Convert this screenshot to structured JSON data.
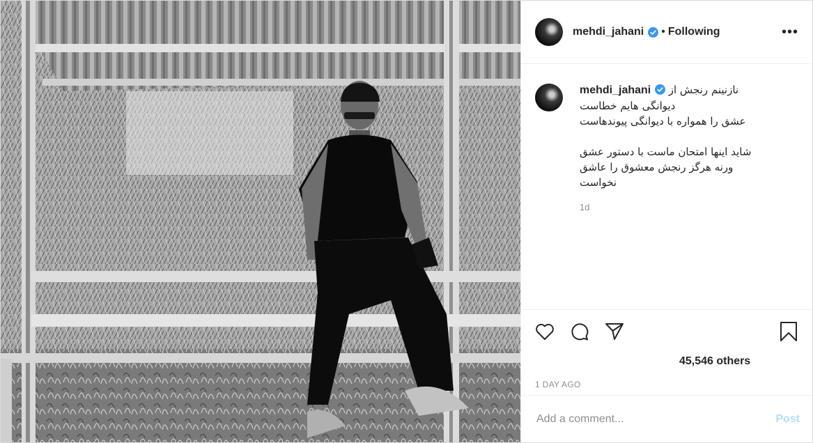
{
  "post": {
    "username": "mehdi_jahani",
    "verified": true,
    "separator": "•",
    "follow_status": "Following",
    "more_icon": "more-horizontal-icon",
    "more_label": "•••"
  },
  "caption": {
    "username": "mehdi_jahani",
    "lines_1": [
      "نازنینم رنجش از",
      "دیوانگی هایم خطاست",
      "عشق را همواره با دیوانگی پیوندهاست"
    ],
    "lines_2": [
      "شاید اینها امتحان ماست با دستور عشق",
      "ورنه هرگز رنجش معشوق را عاشق",
      "نخواست"
    ],
    "age": "1d"
  },
  "actions": {
    "like_icon": "heart-icon",
    "comment_icon": "comment-icon",
    "share_icon": "paper-plane-icon",
    "save_icon": "bookmark-icon"
  },
  "likes_text": "45,546 others",
  "timestamp": "1 DAY AGO",
  "comment_box": {
    "placeholder": "Add a comment...",
    "post_label": "Post"
  },
  "colors": {
    "verified": "#3897f0",
    "post_button_disabled": "#b2dffc",
    "muted_text": "#8e8e8e",
    "border": "#dbdbdb"
  }
}
